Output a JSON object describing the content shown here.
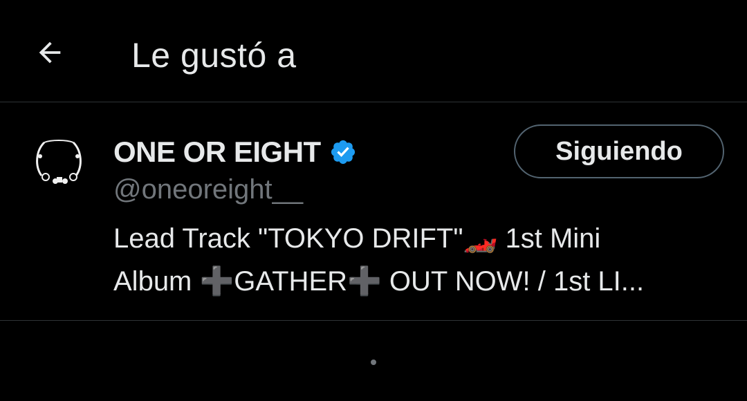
{
  "header": {
    "title": "Le gustó a"
  },
  "user": {
    "name": "ONE OR EIGHT",
    "handle": "@oneoreight__",
    "verified": true,
    "follow_label": "Siguiendo",
    "bio_lines": [
      "Lead Track \"TOKYO DRIFT\"🏎️ 1st Mini",
      "Album ➕GATHER➕ OUT NOW! / 1st LI..."
    ]
  },
  "icons": {
    "back": "arrow-left-icon",
    "verified": "verified-badge-icon"
  },
  "colors": {
    "background": "#000000",
    "text": "#e7e9ea",
    "secondary_text": "#71767b",
    "divider": "#2f3336",
    "verified_blue": "#1d9bf0",
    "button_border": "#536471"
  }
}
